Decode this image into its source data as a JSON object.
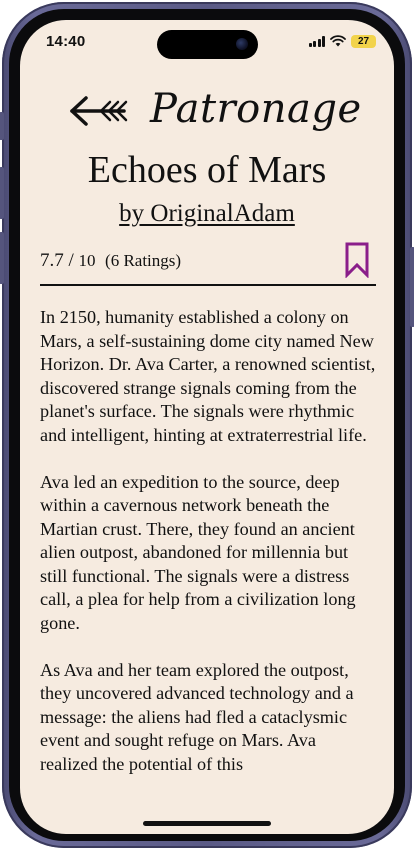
{
  "status_bar": {
    "time": "14:40",
    "battery": "27",
    "icons": [
      "signal-icon",
      "wifi-icon",
      "battery-icon"
    ]
  },
  "header": {
    "back_icon": "back-arrow-icon",
    "brand": "Patronage"
  },
  "story": {
    "title": "Echoes of Mars",
    "author": "by OriginalAdam",
    "rating": "7.7",
    "rating_sep": "/",
    "rating_max": "10",
    "rating_count": "(6 Ratings)",
    "bookmark_icon": "bookmark-icon",
    "paragraphs": [
      "In 2150, humanity established a colony on Mars, a self-sustaining dome city named New Horizon. Dr. Ava Carter, a renowned scientist, discovered strange signals coming from the planet's surface. The signals were rhythmic and intelligent, hinting at extraterrestrial life.",
      "Ava led an expedition to the source, deep within a cavernous network beneath the Martian crust. There, they found an ancient alien outpost, abandoned for millennia but still functional. The signals were a distress call, a plea for help from a civilization long gone.",
      "As Ava and her team explored the outpost, they uncovered advanced technology and a message: the aliens had fled a cataclysmic event and sought refuge on Mars. Ava realized the potential of this"
    ]
  },
  "colors": {
    "background": "#f6ebe0",
    "text": "#111111",
    "accent": "#8a1e8a",
    "battery": "#f2d34b",
    "frame": "#5a5a86"
  }
}
